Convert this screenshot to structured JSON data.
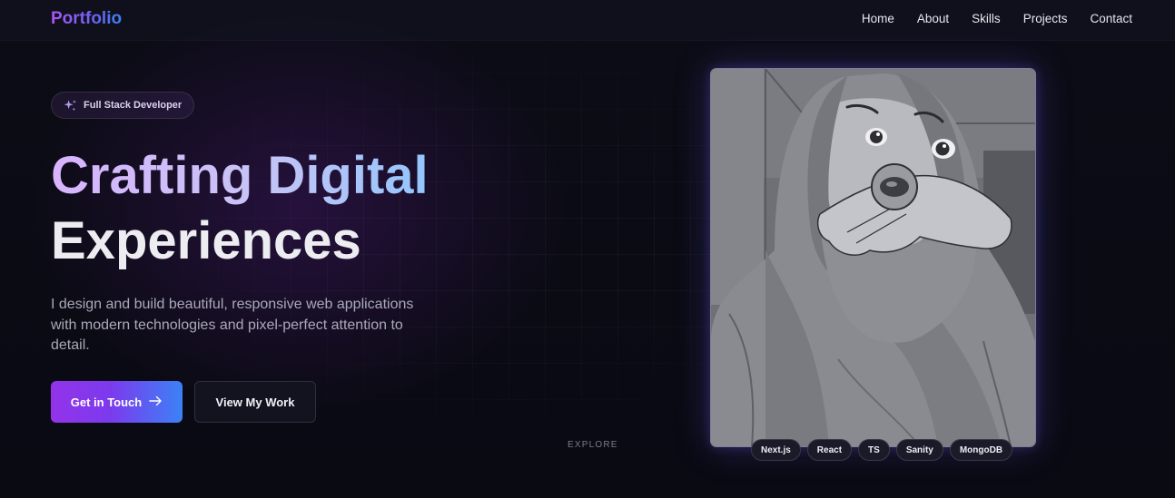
{
  "nav": {
    "logo": "Portfolio",
    "links": [
      "Home",
      "About",
      "Skills",
      "Projects",
      "Contact"
    ]
  },
  "hero": {
    "badge": {
      "icon": "sparkles-icon",
      "label": "Full Stack Developer"
    },
    "title_line1": "Crafting Digital",
    "title_line2": "Experiences",
    "description": "I design and build beautiful, responsive web applications with modern technologies and pixel-perfect attention to detail.",
    "primary_button": {
      "label": "Get in Touch",
      "icon": "arrow-right-icon"
    },
    "secondary_button": {
      "label": "View My Work"
    },
    "scroll_hint": "EXPLORE"
  },
  "profile_image": {
    "alt": "Illustrated portrait"
  },
  "tech_tags": [
    "Next.js",
    "React",
    "TS",
    "Sanity",
    "MongoDB"
  ],
  "colors": {
    "background": "#0b0b14",
    "accent_purple": "#9333ea",
    "accent_blue": "#3b82f6",
    "text": "#e7e7ee",
    "muted_text": "#a9a9b8"
  }
}
